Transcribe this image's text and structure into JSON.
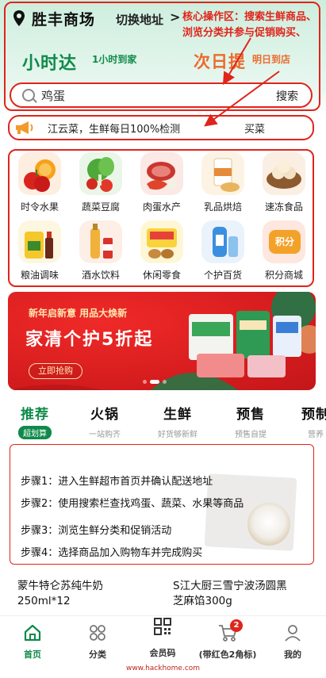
{
  "header": {
    "store_name": "胜丰商场",
    "switch_address": "切换地址",
    "switch_arrow": ">",
    "annotation": "核心操作区：搜索生鲜商品、浏览分类并参与促销购买、",
    "hour_reach": "小时达",
    "hour_reach_sub": "1小时到家",
    "next_day": "次日提",
    "next_day_sub": "明日到店"
  },
  "search": {
    "value": "鸡蛋",
    "button": "搜索"
  },
  "marquee": {
    "text": "江云菜，生鲜每日100%检测",
    "trail": "买菜"
  },
  "categories": [
    {
      "label": "时令水果",
      "icon": "fruit-icon"
    },
    {
      "label": "蔬菜豆腐",
      "icon": "vegetable-icon"
    },
    {
      "label": "肉蛋水产",
      "icon": "meat-icon"
    },
    {
      "label": "乳品烘焙",
      "icon": "dairy-icon"
    },
    {
      "label": "速冻食品",
      "icon": "frozen-food-icon"
    },
    {
      "label": "粮油调味",
      "icon": "grain-oil-icon"
    },
    {
      "label": "酒水饮料",
      "icon": "drinks-icon"
    },
    {
      "label": "休闲零食",
      "icon": "snacks-icon"
    },
    {
      "label": "个护百货",
      "icon": "personal-care-icon"
    },
    {
      "label": "积分商城",
      "icon": "points-mall-icon"
    }
  ],
  "points_badge": "积分",
  "banner": {
    "subtitle": "新年启新意 用品大焕新",
    "title": "家清个护5折起",
    "button": "立即抢购"
  },
  "tabs": [
    {
      "title": "推荐",
      "sub": "超划算"
    },
    {
      "title": "火锅",
      "sub": "一站购齐"
    },
    {
      "title": "生鲜",
      "sub": "好货够新鲜"
    },
    {
      "title": "预售",
      "sub": "预售自提"
    },
    {
      "title": "预制",
      "sub": "营养"
    }
  ],
  "steps": [
    "步骤1：进入生鲜超市首页并确认配送地址",
    "步骤2：使用搜索栏查找鸡蛋、蔬菜、水果等商品",
    "步骤3：浏览生鲜分类和促销活动",
    "步骤4：选择商品加入购物车并完成购买"
  ],
  "products": [
    {
      "name_line1": "蒙牛特仑苏纯牛奶",
      "name_line2": "250ml*12"
    },
    {
      "name_line1": "S江大厨三雪宁波汤圆黑",
      "name_line2": "芝麻馅300g"
    }
  ],
  "nav": [
    {
      "label": "首页",
      "icon": "home-icon"
    },
    {
      "label": "分类",
      "icon": "category-icon"
    },
    {
      "label": "会员码",
      "icon": "qr-code-icon"
    },
    {
      "label": "(带红色2角标)",
      "icon": "cart-icon",
      "badge": "2"
    },
    {
      "label": "我的",
      "icon": "profile-icon"
    }
  ],
  "watermark": "www.hackhome.com",
  "colors": {
    "brand_green": "#0f8a4a",
    "accent_orange": "#ec6a2c",
    "annotation_red": "#e0241b"
  }
}
